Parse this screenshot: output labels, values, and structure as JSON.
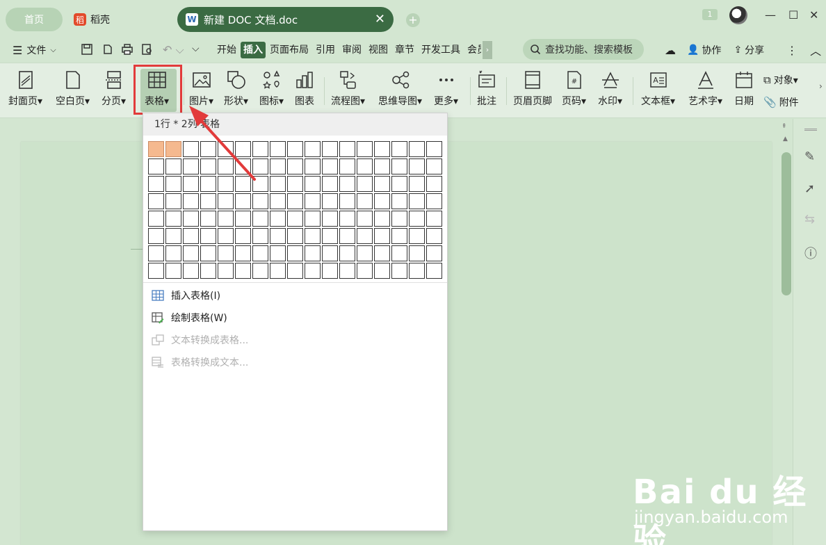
{
  "titlebar": {
    "home_tab": "首页",
    "daoke_tab": "稻壳",
    "daoke_icon": "稻",
    "doc_tab": "新建 DOC 文档.doc",
    "doc_icon": "W",
    "badge_count": "1"
  },
  "menu": {
    "file": "文件",
    "tabs": [
      "开始",
      "插入",
      "页面布局",
      "引用",
      "审阅",
      "视图",
      "章节",
      "开发工具",
      "会员"
    ],
    "active_tab": "插入",
    "search_placeholder": "查找功能、搜索模板",
    "collaborate": "协作",
    "share": "分享"
  },
  "ribbon": {
    "cover": "封面页",
    "blank": "空白页",
    "pagebreak": "分页",
    "table": "表格",
    "picture": "图片",
    "shape": "形状",
    "icon": "图标",
    "chart": "图表",
    "flowchart": "流程图",
    "mindmap": "思维导图",
    "more": "更多",
    "comment": "批注",
    "header_footer": "页眉页脚",
    "page_number": "页码",
    "watermark": "水印",
    "textbox": "文本框",
    "wordart": "艺术字",
    "date": "日期",
    "object": "对象",
    "attachment": "附件"
  },
  "table_dropdown": {
    "header": "1行 * 2列 表格",
    "rows": 8,
    "cols": 17,
    "selected_rows": 1,
    "selected_cols": 2,
    "items": [
      {
        "label": "插入表格(I)",
        "enabled": true
      },
      {
        "label": "绘制表格(W)",
        "enabled": true
      },
      {
        "label": "文本转换成表格...",
        "enabled": false
      },
      {
        "label": "表格转换成文本...",
        "enabled": false
      }
    ]
  },
  "watermark": {
    "brand": "Bai du 经验",
    "url": "jingyan.baidu.com"
  },
  "colors": {
    "accent": "#3b6b43",
    "highlight": "#e23b3b",
    "cell_selected": "#f5b98f"
  }
}
